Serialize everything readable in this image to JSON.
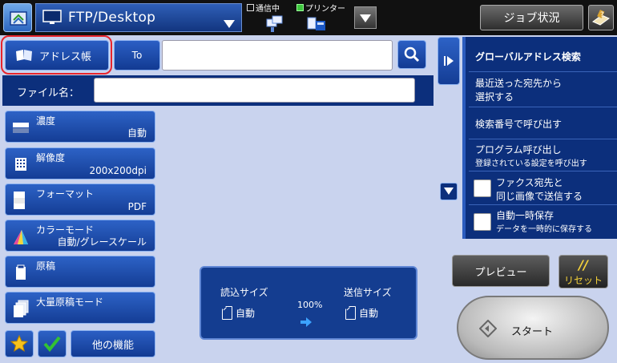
{
  "header": {
    "mode_title": "FTP/Desktop",
    "status_communicating": "通信中",
    "status_printer": "プリンター",
    "job_status_label": "ジョブ状況"
  },
  "address": {
    "address_book_label": "アドレス帳",
    "to_label": "To",
    "to_value": "",
    "filename_label": "ファイル名：",
    "filename_value": ""
  },
  "functions": [
    {
      "title": "濃度",
      "value": "自動",
      "icon": "density-icon"
    },
    {
      "title": "解像度",
      "value": "200x200dpi",
      "icon": "resolution-icon"
    },
    {
      "title": "フォーマット",
      "value": "PDF",
      "icon": "format-icon"
    },
    {
      "title": "カラーモード",
      "value": "自動/グレースケール",
      "icon": "color-mode-icon"
    },
    {
      "title": "原稿",
      "value": "",
      "icon": "original-icon"
    },
    {
      "title": "大量原稿モード",
      "value": "",
      "icon": "batch-original-icon"
    }
  ],
  "bottom_left": {
    "other_functions_label": "他の機能"
  },
  "size_panel": {
    "scan_size_label": "読込サイズ",
    "scan_size_value": "自動",
    "send_size_label": "送信サイズ",
    "send_size_value": "自動",
    "ratio": "100%"
  },
  "right_panel": {
    "items": [
      {
        "main": "グローバルアドレス検索",
        "sub": ""
      },
      {
        "main": "最近送った宛先から",
        "sub": "選択する"
      },
      {
        "main": "検索番号で呼び出す",
        "sub": ""
      },
      {
        "main": "プログラム呼び出し",
        "sub": "登録されている設定を呼び出す"
      },
      {
        "main": "ファクス宛先と",
        "sub": "同じ画像で送信する"
      },
      {
        "main": "自動一時保存",
        "sub": "データを一時的に保存する"
      }
    ]
  },
  "actions": {
    "preview_label": "プレビュー",
    "reset_mark": "//",
    "reset_label": "リセット",
    "start_label": "スタート"
  },
  "colors": {
    "background": "#c9d3ee",
    "button_blue": "#143d95",
    "panel_navy": "#0c2f7c",
    "highlight_red": "#e8242c"
  }
}
